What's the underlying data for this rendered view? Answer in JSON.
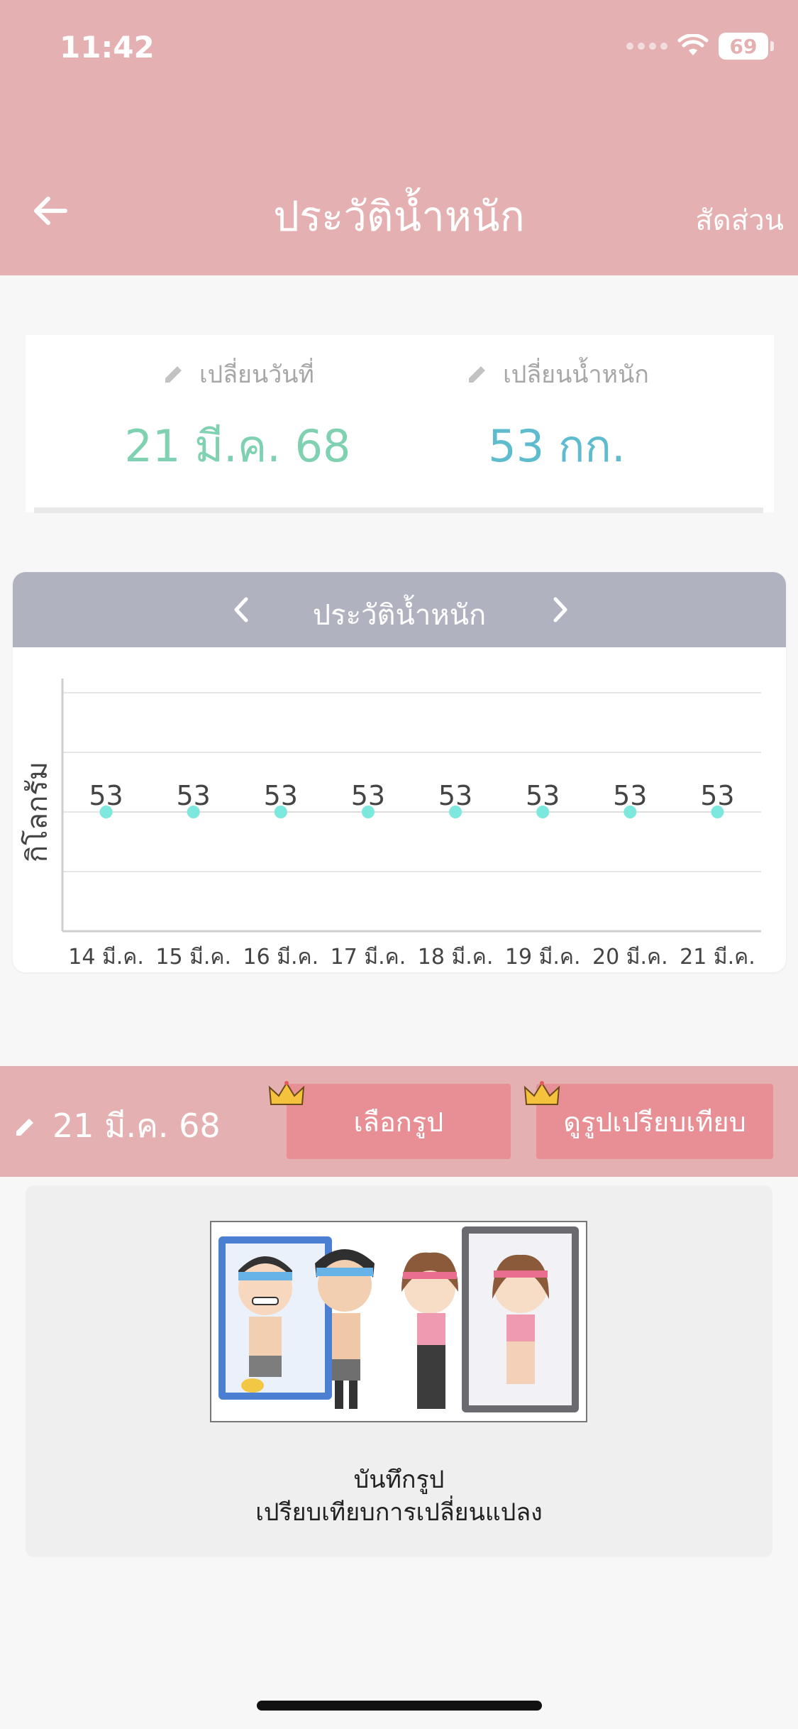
{
  "status": {
    "time": "11:42",
    "battery": "69"
  },
  "nav": {
    "title": "ประวัติน้ำหนัก",
    "right_link": "สัดส่วน"
  },
  "summary": {
    "date_label": "เปลี่ยนวันที่",
    "date_value": "21 มี.ค. 68",
    "weight_label": "เปลี่ยนน้ำหนัก",
    "weight_value": "53 กก."
  },
  "chart_header": {
    "title": "ประวัติน้ำหนัก"
  },
  "chart_data": {
    "type": "line",
    "title": "ประวัติน้ำหนัก",
    "ylabel": "กิโลกรัม",
    "xlabel": "",
    "categories": [
      "14 มี.ค.",
      "15 มี.ค.",
      "16 มี.ค.",
      "17 มี.ค.",
      "18 มี.ค.",
      "19 มี.ค.",
      "20 มี.ค.",
      "21 มี.ค."
    ],
    "series": [
      {
        "values": [
          53,
          53,
          53,
          53,
          53,
          53,
          53,
          53
        ]
      }
    ],
    "ylim": [
      51,
      55
    ],
    "grid": true,
    "point_color": "#7de8dd"
  },
  "photo_bar": {
    "date": "21 มี.ค. 68",
    "select_label": "เลือกรูป",
    "compare_label": "ดูรูปเปรียบเทียบ"
  },
  "photo": {
    "caption_line1": "บันทึกรูป",
    "caption_line2": "เปรียบเทียบการเปลี่ยนแปลง"
  },
  "colors": {
    "header": "#e5b0b1",
    "button": "#e78f94",
    "date_accent": "#7fd1b2",
    "weight_accent": "#5fbccf"
  }
}
